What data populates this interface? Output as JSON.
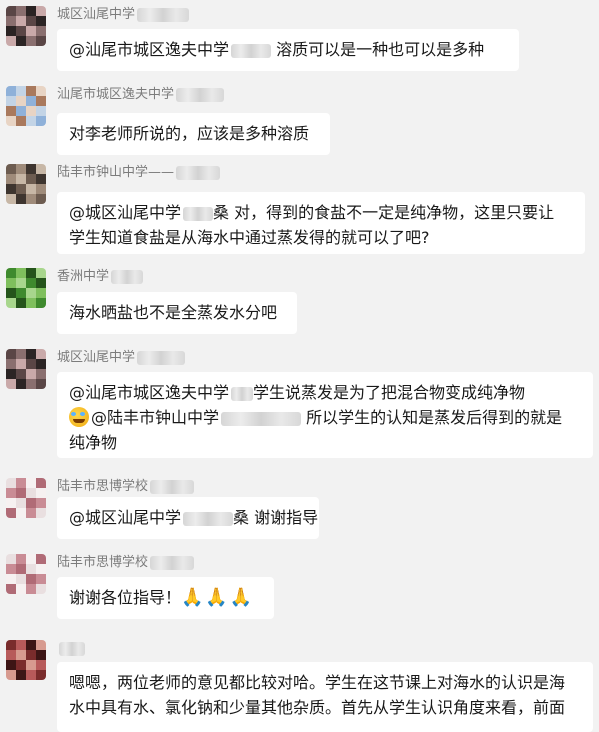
{
  "messages": [
    {
      "sender": "城区汕尾中学",
      "avatar_colors": [
        "#5a4646",
        "#8a6f6f",
        "#2b2424",
        "#c9a9a9"
      ],
      "lines": [
        [
          "@汕尾市城区逸夫中学",
          "blur",
          " 溶质可以是一种也可以是多种"
        ]
      ]
    },
    {
      "sender": "汕尾市城区逸夫中学",
      "avatar_colors": [
        "#8fb1d9",
        "#c3d4e6",
        "#a9795d",
        "#e8d4c4"
      ],
      "lines": [
        [
          "对李老师所说的，应该是多种溶质"
        ]
      ]
    },
    {
      "sender": "陆丰市钟山中学——",
      "avatar_colors": [
        "#6d5c50",
        "#9f8b7a",
        "#3e352f",
        "#c7b7a6"
      ],
      "lines": [
        [
          "@城区汕尾中学",
          "blur",
          "桑 对，得到的食盐不一定是纯净物，这里只要让"
        ],
        [
          "学生知道食盐是从海水中通过蒸发得的就可以了吧?"
        ]
      ]
    },
    {
      "sender": "香洲中学",
      "avatar_colors": [
        "#3f8a2e",
        "#7fbf5d",
        "#25541b",
        "#a8d68d"
      ],
      "lines": [
        [
          "海水晒盐也不是全蒸发水分吧"
        ]
      ]
    },
    {
      "sender": "城区汕尾中学",
      "avatar_colors": [
        "#5a4646",
        "#8a6f6f",
        "#2b2424",
        "#c9a9a9"
      ],
      "lines": [
        [
          "@汕尾市城区逸夫中学",
          "blur",
          "学生说蒸发是为了把混合物变成纯净物"
        ],
        [
          "emoji",
          "@陆丰市钟山中学",
          "blur",
          " 所以学生的认知是蒸发后得到的就是"
        ],
        [
          "纯净物"
        ]
      ]
    },
    {
      "sender": "陆丰市思博学校",
      "avatar_colors": [
        "#e9dfe0",
        "#c98c95",
        "#f6f1f1",
        "#b06b76"
      ],
      "lines": [
        [
          "@城区汕尾中学",
          "blur",
          "桑 谢谢指导"
        ]
      ]
    },
    {
      "sender": "陆丰市思博学校",
      "avatar_colors": [
        "#e9dfe0",
        "#c98c95",
        "#f6f1f1",
        "#b06b76"
      ],
      "lines": [
        [
          "谢谢各位指导！",
          "hands"
        ]
      ]
    },
    {
      "sender": "",
      "avatar_colors": [
        "#7a2c2c",
        "#b75a5a",
        "#3d1515",
        "#d79a8f"
      ],
      "lines": [
        [
          "嗯嗯，两位老师的意见都比较对哈。学生在这节课上对海水的认识是海"
        ],
        [
          "水中具有水、氯化钠和少量其他杂质。首先从学生认识角度来看，前面"
        ]
      ]
    }
  ],
  "hands_emoji": "🙏🙏🙏"
}
